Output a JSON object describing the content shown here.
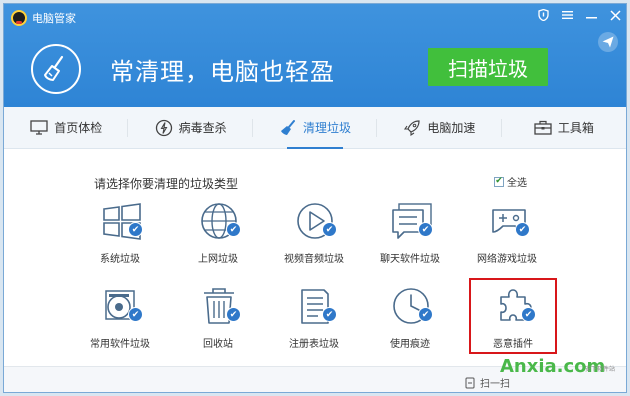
{
  "app": {
    "title": "电脑管家"
  },
  "window_controls": [
    "shield-icon",
    "menu-icon",
    "minimize-icon",
    "close-icon"
  ],
  "hero": {
    "slogan": "常清理，电脑也轻盈",
    "scan_button": "扫描垃圾"
  },
  "tabs": [
    {
      "label": "首页体检",
      "icon": "monitor-icon",
      "active": false
    },
    {
      "label": "病毒查杀",
      "icon": "lightning-icon",
      "active": false
    },
    {
      "label": "清理垃圾",
      "icon": "broom-icon",
      "active": true
    },
    {
      "label": "电脑加速",
      "icon": "rocket-icon",
      "active": false
    },
    {
      "label": "工具箱",
      "icon": "toolbox-icon",
      "active": false
    }
  ],
  "content": {
    "prompt": "请选择你要清理的垃圾类型",
    "select_all": {
      "label": "全选",
      "checked": true
    },
    "items": [
      {
        "label": "系统垃圾",
        "icon": "windows-icon",
        "checked": true
      },
      {
        "label": "上网垃圾",
        "icon": "globe-icon",
        "checked": true
      },
      {
        "label": "视频音频垃圾",
        "icon": "play-icon",
        "checked": true
      },
      {
        "label": "聊天软件垃圾",
        "icon": "chat-icon",
        "checked": true
      },
      {
        "label": "网络游戏垃圾",
        "icon": "gamepad-icon",
        "checked": true
      },
      {
        "label": "常用软件垃圾",
        "icon": "disc-icon",
        "checked": true
      },
      {
        "label": "回收站",
        "icon": "trash-icon",
        "checked": true
      },
      {
        "label": "注册表垃圾",
        "icon": "document-icon",
        "checked": true
      },
      {
        "label": "使用痕迹",
        "icon": "clock-icon",
        "checked": true
      },
      {
        "label": "恶意插件",
        "icon": "puzzle-icon",
        "checked": true
      }
    ]
  },
  "footer": {
    "action_label": "扫一扫"
  },
  "watermark": {
    "main": "Anxia.com",
    "sub": "安下软件站"
  },
  "colors": {
    "header": "#3a8cdb",
    "scan_button": "#41bf3c",
    "accent": "#2f7fd0",
    "highlight": "#d8171a",
    "watermark": "#4ab84a"
  }
}
